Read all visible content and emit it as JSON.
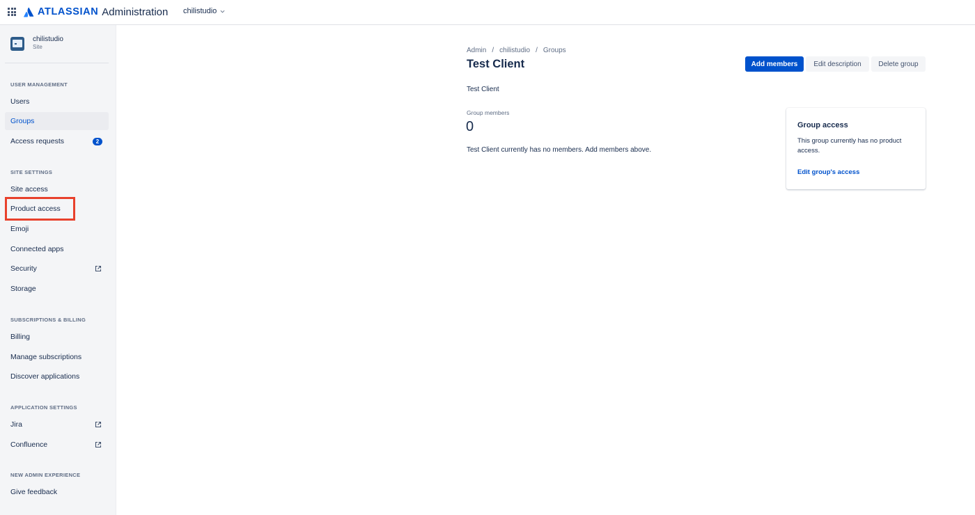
{
  "topbar": {
    "brand": "ATLASSIAN",
    "product": "Administration",
    "site_switcher": "chilistudio"
  },
  "sidebar": {
    "site": {
      "name": "chilistudio",
      "type": "Site"
    },
    "sections": {
      "user_management": "USER MANAGEMENT",
      "site_settings": "SITE SETTINGS",
      "subscriptions": "SUBSCRIPTIONS & BILLING",
      "application_settings": "APPLICATION SETTINGS",
      "new_admin": "NEW ADMIN EXPERIENCE"
    },
    "items": {
      "users": "Users",
      "groups": "Groups",
      "access_requests": "Access requests",
      "access_requests_badge": "2",
      "site_access": "Site access",
      "product_access": "Product access",
      "emoji": "Emoji",
      "connected_apps": "Connected apps",
      "security": "Security",
      "storage": "Storage",
      "billing": "Billing",
      "manage_subscriptions": "Manage subscriptions",
      "discover_applications": "Discover applications",
      "jira": "Jira",
      "confluence": "Confluence",
      "give_feedback": "Give feedback"
    },
    "active_item": "Groups"
  },
  "breadcrumb": [
    "Admin",
    "chilistudio",
    "Groups"
  ],
  "group": {
    "title": "Test Client",
    "description": "Test Client",
    "members_label": "Group members",
    "members_count": "0",
    "members_empty": "Test Client currently has no members. Add members above."
  },
  "actions": {
    "add_members": "Add members",
    "edit_description": "Edit description",
    "delete_group": "Delete group"
  },
  "access_card": {
    "title": "Group access",
    "text": "This group currently has no product access.",
    "link": "Edit group's access"
  },
  "colors": {
    "primary": "#0052cc",
    "highlight": "#e8412c",
    "sidebar_bg": "#f4f5f7",
    "text": "#172b4d"
  }
}
